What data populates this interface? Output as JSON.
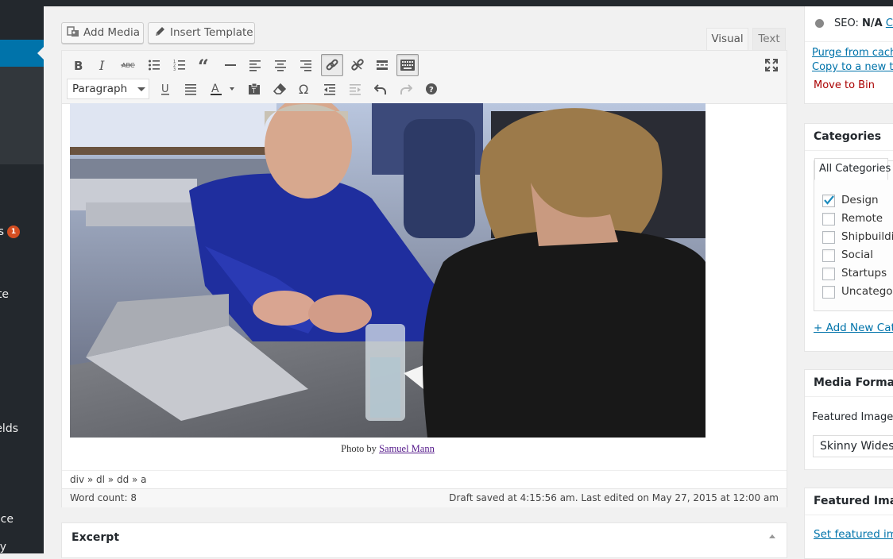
{
  "sidebar": {
    "badge_count": "1",
    "labels": [
      "s",
      "te",
      "elds",
      "nce",
      "y"
    ]
  },
  "media_buttons": {
    "add_media": "Add Media",
    "insert_template": "Insert Template"
  },
  "editor_tabs": {
    "visual": "Visual",
    "text": "Text"
  },
  "toolbar": {
    "format_select": "Paragraph",
    "icons_row1": [
      "bold-icon",
      "italic-icon",
      "strikethrough-icon",
      "bullet-list-icon",
      "numbered-list-icon",
      "blockquote-icon",
      "horizontal-rule-icon",
      "align-left-icon",
      "align-center-icon",
      "align-right-icon",
      "insert-link-icon",
      "remove-link-icon",
      "read-more-icon",
      "toolbar-toggle-icon",
      "fullscreen-icon"
    ],
    "icons_row2": [
      "underline-icon",
      "justify-icon",
      "text-color-icon",
      "paste-text-icon",
      "clear-formatting-icon",
      "special-character-icon",
      "outdent-icon",
      "indent-icon",
      "undo-icon",
      "redo-icon",
      "help-icon"
    ],
    "active": [
      "insert-link-icon",
      "toolbar-toggle-icon"
    ]
  },
  "content": {
    "caption_prefix": "Photo by ",
    "caption_link": "Samuel Mann"
  },
  "status": {
    "path": "div » dl » dd » a",
    "word_count": "Word count: 8",
    "draft_saved": "Draft saved at 4:15:56 am. Last edited on May 27, 2015 at 12:00 am"
  },
  "excerpt": {
    "title": "Excerpt"
  },
  "publish_box": {
    "seo_label": "SEO:",
    "seo_value": "N/A",
    "seo_link": "Ch",
    "purge_cache": "Purge from cache",
    "copy_draft": "Copy to a new te",
    "move_to_bin": "Move to Bin"
  },
  "categories": {
    "title": "Categories",
    "tab_all": "All Categories",
    "items": [
      {
        "label": "Design",
        "checked": true
      },
      {
        "label": "Remote",
        "checked": false
      },
      {
        "label": "Shipbuildir",
        "checked": false
      },
      {
        "label": "Social",
        "checked": false
      },
      {
        "label": "Startups",
        "checked": false
      },
      {
        "label": "Uncategor",
        "checked": false
      }
    ],
    "add_new": "+ Add New Cate"
  },
  "media_formatting": {
    "title": "Media Formatt",
    "featured_label": "Featured Image",
    "featured_value": "Skinny Widesc"
  },
  "featured_image": {
    "title": "Featured Image",
    "set_link": "Set featured ima"
  },
  "colors": {
    "admin_dark": "#23282d",
    "accent_blue": "#0073aa",
    "badge": "#d54e21",
    "bin_red": "#a00"
  }
}
